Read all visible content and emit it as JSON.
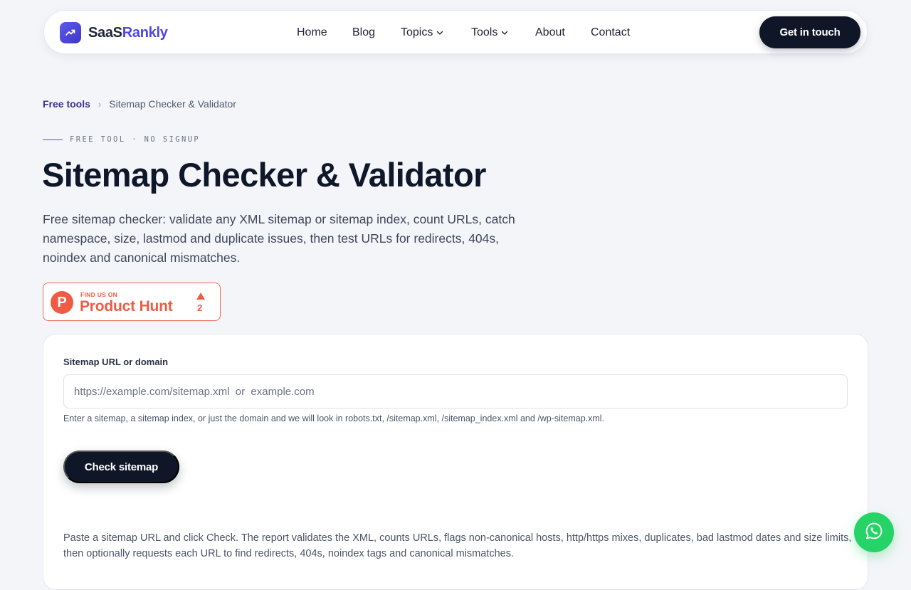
{
  "header": {
    "logo_part1": "SaaS",
    "logo_part2": "Rankly",
    "logo_icon": "trend-up-icon",
    "nav": [
      {
        "label": "Home",
        "has_dropdown": false
      },
      {
        "label": "Blog",
        "has_dropdown": false
      },
      {
        "label": "Topics",
        "has_dropdown": true
      },
      {
        "label": "Tools",
        "has_dropdown": true
      },
      {
        "label": "About",
        "has_dropdown": false
      },
      {
        "label": "Contact",
        "has_dropdown": false
      }
    ],
    "cta_label": "Get in touch"
  },
  "breadcrumb": {
    "root": "Free tools",
    "separator": "›",
    "current": "Sitemap Checker & Validator"
  },
  "hero": {
    "eyebrow": "FREE TOOL · NO SIGNUP",
    "title": "Sitemap Checker & Validator",
    "description": "Free sitemap checker: validate any XML sitemap or sitemap index, count URLs, catch namespace, size, lastmod and duplicate issues, then test URLs for redirects, 404s, noindex and canonical mismatches."
  },
  "product_hunt": {
    "small_text": "FIND US ON",
    "big_text": "Product Hunt",
    "logo_letter": "P",
    "upvotes": "2"
  },
  "tool": {
    "field_label": "Sitemap URL or domain",
    "input_value": "",
    "input_placeholder": "https://example.com/sitemap.xml  or  example.com",
    "help_text": "Enter a sitemap, a sitemap index, or just the domain and we will look in robots.txt, /sitemap.xml, /sitemap_index.xml and /wp-sitemap.xml.",
    "submit_label": "Check sitemap",
    "note": "Paste a sitemap URL and click Check. The report validates the XML, counts URLs, flags non-canonical hosts, http/https mixes, duplicates, bad lastmod dates and size limits, then optionally requests each URL to find redirects, 404s, noindex tags and canonical mismatches."
  },
  "floating": {
    "icon": "whatsapp-icon"
  },
  "colors": {
    "accent": "#4f46e5",
    "dark": "#0f1628",
    "product_hunt": "#ef5b45",
    "whatsapp": "#25d366",
    "background": "#f4f5f9"
  }
}
